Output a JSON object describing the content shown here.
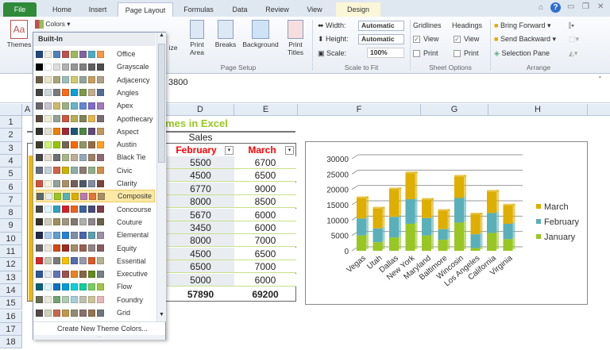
{
  "tabs": [
    "File",
    "Home",
    "Insert",
    "Page Layout",
    "Formulas",
    "Data",
    "Review",
    "View",
    "Design"
  ],
  "ribbon": {
    "themes": "Themes",
    "colors": "Colors",
    "size": "ize",
    "print_area": "Print Area",
    "breaks": "Breaks",
    "background": "Background",
    "print_titles": "Print Titles",
    "page_setup": "Page Setup",
    "width_label": "Width:",
    "width_val": "Automatic",
    "height_label": "Height:",
    "height_val": "Automatic",
    "scale_label": "Scale:",
    "scale_val": "100%",
    "scale_to_fit": "Scale to Fit",
    "gridlines": "Gridlines",
    "headings": "Headings",
    "view": "View",
    "print": "Print",
    "sheet_options": "Sheet Options",
    "bring_forward": "Bring Forward",
    "send_backward": "Send Backward",
    "selection_pane": "Selection Pane",
    "arrange": "Arrange"
  },
  "formula_value": "3800",
  "columns": [
    "A",
    "D",
    "E",
    "F",
    "G",
    "H"
  ],
  "rows": [
    "1",
    "2",
    "3",
    "4",
    "5",
    "6",
    "7",
    "8",
    "9",
    "10",
    "11",
    "12",
    "13",
    "14",
    "15",
    "16",
    "17",
    "18"
  ],
  "sheet": {
    "title": "Themes in Excel",
    "sales": "Sales",
    "feb": "February",
    "mar": "March",
    "feb_values": [
      "5500",
      "4500",
      "6770",
      "8000",
      "5670",
      "3450",
      "8000",
      "4500",
      "6500",
      "5000"
    ],
    "mar_values": [
      "6700",
      "6500",
      "9000",
      "8500",
      "6000",
      "6000",
      "7000",
      "6500",
      "7000",
      "6000"
    ],
    "feb_total": "57890",
    "mar_total": "69200"
  },
  "dropdown": {
    "header": "Built-In",
    "selected": "Composite",
    "create": "Create New Theme Colors...",
    "themes": [
      {
        "name": "Office",
        "c": [
          "#1F497D",
          "#EEECE1",
          "#4F81BD",
          "#C0504D",
          "#9BBB59",
          "#8064A2",
          "#4BACC6",
          "#F79646"
        ]
      },
      {
        "name": "Grayscale",
        "c": [
          "#000000",
          "#FFFFFF",
          "#DDDDDD",
          "#B2B2B2",
          "#969696",
          "#808080",
          "#5F5F5F",
          "#4D4D4D"
        ]
      },
      {
        "name": "Adjacency",
        "c": [
          "#695D46",
          "#E8E5C8",
          "#A9A57C",
          "#9CBEBD",
          "#D2CB6C",
          "#95A39D",
          "#C89F5D",
          "#B1A089"
        ]
      },
      {
        "name": "Angles",
        "c": [
          "#434343",
          "#CDD7D9",
          "#797B7E",
          "#F96A1B",
          "#08A1D9",
          "#7C984A",
          "#C2AD8D",
          "#506E94"
        ]
      },
      {
        "name": "Apex",
        "c": [
          "#69676D",
          "#C9C2D1",
          "#CEB966",
          "#9CB084",
          "#6BB1C9",
          "#6585CF",
          "#7E6BC9",
          "#A379BB"
        ]
      },
      {
        "name": "Apothecary",
        "c": [
          "#564B3C",
          "#ECEDD1",
          "#93A299",
          "#CF543F",
          "#B5AE53",
          "#848058",
          "#E8B54D",
          "#786C71"
        ]
      },
      {
        "name": "Aspect",
        "c": [
          "#323232",
          "#E3DED1",
          "#F07F09",
          "#9F2936",
          "#1B587C",
          "#4E8542",
          "#604878",
          "#C19859"
        ]
      },
      {
        "name": "Austin",
        "c": [
          "#3E3D2D",
          "#CAF278",
          "#94C600",
          "#71685A",
          "#FF6700",
          "#909465",
          "#956B43",
          "#FEA022"
        ]
      },
      {
        "name": "Black Tie",
        "c": [
          "#46464A",
          "#E3DCCF",
          "#6F6F74",
          "#A7B789",
          "#BEAE98",
          "#92A9B9",
          "#9C8265",
          "#8D6974"
        ]
      },
      {
        "name": "Civic",
        "c": [
          "#646B86",
          "#C5D1D7",
          "#D16349",
          "#CCB400",
          "#8CADAE",
          "#8C7B70",
          "#8FB08C",
          "#D19049"
        ]
      },
      {
        "name": "Clarity",
        "c": [
          "#D2533C",
          "#F3F2DC",
          "#93A299",
          "#AD8F67",
          "#726056",
          "#4C5A6A",
          "#808DA0",
          "#79463D"
        ]
      },
      {
        "name": "Composite",
        "c": [
          "#5B6973",
          "#E7ECED",
          "#98C723",
          "#59B0B9",
          "#DEAE00",
          "#B77BB4",
          "#E0773C",
          "#A98D63"
        ]
      },
      {
        "name": "Concourse",
        "c": [
          "#464646",
          "#DEF5FA",
          "#2DA2BF",
          "#DA1F28",
          "#EB641B",
          "#39639D",
          "#474B78",
          "#7D3C4A"
        ]
      },
      {
        "name": "Couture",
        "c": [
          "#37302A",
          "#D0CCB9",
          "#9E8E5C",
          "#A09781",
          "#85776D",
          "#AEAFA9",
          "#8D878B",
          "#6B6149"
        ]
      },
      {
        "name": "Elemental",
        "c": [
          "#242852",
          "#ACCCEA",
          "#629DD1",
          "#297FD5",
          "#7F8FA9",
          "#4A66AC",
          "#5AA2AE",
          "#9D90A0"
        ]
      },
      {
        "name": "Equity",
        "c": [
          "#696464",
          "#E9E5DC",
          "#D34817",
          "#9B2D1F",
          "#A28E6A",
          "#956251",
          "#918485",
          "#855D5D"
        ]
      },
      {
        "name": "Essential",
        "c": [
          "#D1282E",
          "#C8C8B1",
          "#7A7A7A",
          "#F5C201",
          "#526DB0",
          "#989AAC",
          "#DC5924",
          "#B4B392"
        ]
      },
      {
        "name": "Executive",
        "c": [
          "#2F5897",
          "#E4E9EF",
          "#6076B4",
          "#9C5252",
          "#E68422",
          "#846648",
          "#63891F",
          "#758085"
        ]
      },
      {
        "name": "Flow",
        "c": [
          "#04617B",
          "#DBF5F9",
          "#0F6FC6",
          "#009DD9",
          "#0BD0D9",
          "#10CF9B",
          "#7CCA62",
          "#A5C249"
        ]
      },
      {
        "name": "Foundry",
        "c": [
          "#676A55",
          "#EAEBDE",
          "#72A376",
          "#B0CCB0",
          "#A8CDD7",
          "#C0BEAF",
          "#CEC597",
          "#E8B7B7"
        ]
      },
      {
        "name": "Grid",
        "c": [
          "#534949",
          "#CCD1B9",
          "#C66951",
          "#BF974D",
          "#928B70",
          "#87706B",
          "#94734E",
          "#6F777D"
        ]
      }
    ]
  },
  "chart_data": {
    "type": "bar",
    "stacked": true,
    "title": "",
    "xlabel": "",
    "ylabel": "",
    "ylim": [
      0,
      30000
    ],
    "yticks": [
      "0",
      "5000",
      "10000",
      "15000",
      "20000",
      "25000",
      "30000"
    ],
    "legend": "right",
    "grid": true,
    "categories": [
      "Vegas",
      "Utah",
      "Dallas",
      "New York",
      "Maryland",
      "Baltimore",
      "Wincosin",
      "Los Angeles",
      "California",
      "Virginia"
    ],
    "series": [
      {
        "name": "January",
        "color": "#98C723",
        "values": [
          5000,
          2800,
          4300,
          8800,
          5000,
          3600,
          9200,
          900,
          5800,
          3800
        ]
      },
      {
        "name": "February",
        "color": "#59B0B9",
        "values": [
          5500,
          4500,
          6770,
          8000,
          5670,
          3450,
          8000,
          4500,
          6500,
          5000
        ]
      },
      {
        "name": "March",
        "color": "#DEAE00",
        "values": [
          6700,
          6500,
          9000,
          8500,
          6000,
          6000,
          7000,
          6500,
          7000,
          6000
        ]
      }
    ]
  }
}
